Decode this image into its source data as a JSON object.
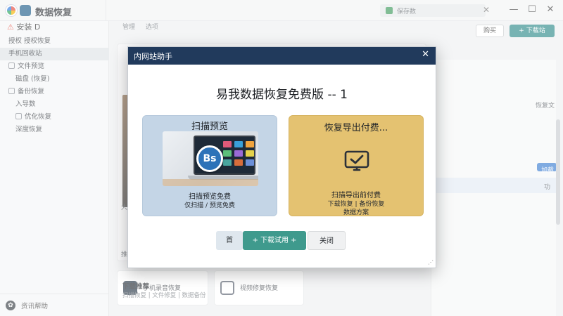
{
  "window": {
    "app_title": "数据恢复",
    "logo_glyph": "",
    "tab_label": "保存数",
    "tab_close": "✕",
    "win_min": "—",
    "win_max": "☐",
    "win_close": "✕"
  },
  "sidebar": {
    "header": "安装",
    "header_suffix": "D",
    "items": [
      {
        "label": "授权 授权恢复",
        "selected": false
      },
      {
        "label": "手机回收站",
        "selected": true
      },
      {
        "label": "文件预览",
        "selected": false
      },
      {
        "label": "磁盘 (恢复)",
        "selected": false
      },
      {
        "label": "备份恢复",
        "selected": false
      },
      {
        "label": "入导数",
        "selected": false
      },
      {
        "label": "优化恢复",
        "selected": false
      },
      {
        "label": "深度恢复",
        "selected": false
      }
    ],
    "footer_icon": "✿",
    "footer_label": "资讯帮助"
  },
  "main": {
    "crumbs": [
      "管理",
      "选项"
    ],
    "btn_secondary": "购买",
    "btn_primary": "+ 下载站",
    "labels": {
      "side_a": "大",
      "side_b": "推",
      "rp_1": "恢复文",
      "rp_2": "加载",
      "rp_3": "功"
    },
    "bottom_cards": [
      "手机录音恢复",
      "视频修复恢复"
    ],
    "bottom_title": "下载推荐",
    "bottom_sub": "扫描恢复 | 文件修复 | 数据备份"
  },
  "modal": {
    "title": "内网站助手",
    "close_icon": "✕",
    "heading": "易我数据恢复免费版 -- 1",
    "options": [
      {
        "title": "扫描预览",
        "badge_text": "Bs",
        "desc_lines": [
          "扫描预览免费",
          "仅扫描 / 预览免费"
        ]
      },
      {
        "title": "恢复导出付费...",
        "desc_lines": [
          "扫描导出前付费",
          "下载恢复 | 备份恢复",
          "数据方案"
        ]
      }
    ],
    "buttons": {
      "prev": "首",
      "download": "+ 下载试用 +",
      "close": "关闭"
    },
    "resize_glyph": "⋰"
  },
  "colors": {
    "modal_header": "#213a5c",
    "option_a_bg": "#c4d5e6",
    "option_b_bg": "#e4c271",
    "primary_button": "#3f9a8d",
    "app_primary": "#2f8a8a"
  }
}
